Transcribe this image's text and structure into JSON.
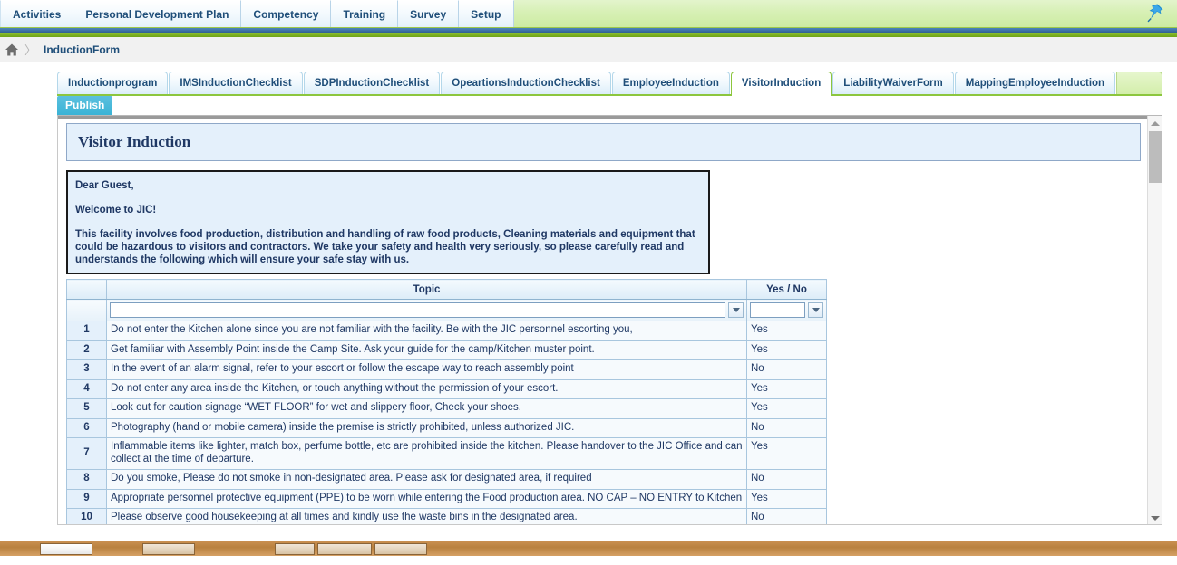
{
  "topnav": {
    "items": [
      {
        "label": "Activities"
      },
      {
        "label": "Personal Development Plan"
      },
      {
        "label": "Competency"
      },
      {
        "label": "Training"
      },
      {
        "label": "Survey"
      },
      {
        "label": "Setup"
      }
    ],
    "pin_icon": "pushpin-icon",
    "accent_green": "#8cc63e",
    "accent_blue": "#3f74a8"
  },
  "breadcrumb": {
    "home_icon": "home-icon",
    "separator": "〉",
    "current": "InductionForm"
  },
  "subtabs": {
    "items": [
      {
        "label": "Inductionprogram",
        "active": false
      },
      {
        "label": "IMSInductionChecklist",
        "active": false
      },
      {
        "label": "SDPInductionChecklist",
        "active": false
      },
      {
        "label": "OpeartionsInductionChecklist",
        "active": false
      },
      {
        "label": "EmployeeInduction",
        "active": false
      },
      {
        "label": "VisitorInduction",
        "active": true
      },
      {
        "label": "LiabilityWaiverForm",
        "active": false
      },
      {
        "label": "MappingEmployeeInduction",
        "active": false
      }
    ]
  },
  "toolbar": {
    "publish_label": "Publish"
  },
  "form": {
    "title": "Visitor Induction",
    "welcome": {
      "salutation": "Dear Guest,",
      "greeting": "Welcome to JIC!",
      "body": "This facility involves food production, distribution and handling of raw food products, Cleaning materials and equipment that could be hazardous to visitors and contractors. We take your safety and health very seriously, so please carefully read and understands the following which will ensure your safe stay with us."
    }
  },
  "grid": {
    "columns": [
      "",
      "Topic",
      "Yes / No"
    ],
    "filter": {
      "topic_value": "",
      "topic_placeholder": "",
      "yesno_value": "",
      "yesno_placeholder": "",
      "dropdown_icon": "chevron-down-icon"
    },
    "rows": [
      {
        "num": "1",
        "topic": "Do not enter the Kitchen alone since you are not familiar with the facility. Be with the JIC personnel escorting you,",
        "yesno": "Yes"
      },
      {
        "num": "2",
        "topic": "Get familiar with Assembly Point inside the Camp Site. Ask your guide for the camp/Kitchen muster point.",
        "yesno": "Yes"
      },
      {
        "num": "3",
        "topic": "In the event of an alarm signal, refer to your escort or follow the escape way to reach assembly point",
        "yesno": "No"
      },
      {
        "num": "4",
        "topic": "Do not enter any area inside the Kitchen, or touch anything without the permission of your escort.",
        "yesno": "Yes"
      },
      {
        "num": "5",
        "topic": "Look out for caution signage “WET FLOOR” for wet and slippery floor, Check your shoes.",
        "yesno": "Yes"
      },
      {
        "num": "6",
        "topic": "Photography (hand or mobile camera) inside the premise is strictly prohibited, unless authorized JIC.",
        "yesno": "No"
      },
      {
        "num": "7",
        "topic": "Inflammable items like lighter, match box, perfume bottle, etc are prohibited inside the kitchen. Please handover to the JIC Office and can collect at the time of departure.",
        "yesno": "Yes"
      },
      {
        "num": "8",
        "topic": "Do you smoke, Please do not smoke in non-designated area. Please ask for designated area, if required",
        "yesno": "No"
      },
      {
        "num": "9",
        "topic": "Appropriate personnel protective equipment (PPE) to be worn while entering the Food production area. NO CAP – NO ENTRY to Kitchen",
        "yesno": "Yes"
      },
      {
        "num": "10",
        "topic": "Please observe good housekeeping at all times and kindly use the waste bins in the designated area.",
        "yesno": "No"
      }
    ]
  },
  "scrollbar": {
    "up_icon": "triangle-up-icon",
    "down_icon": "triangle-down-icon",
    "thumb": "scroll-thumb"
  }
}
